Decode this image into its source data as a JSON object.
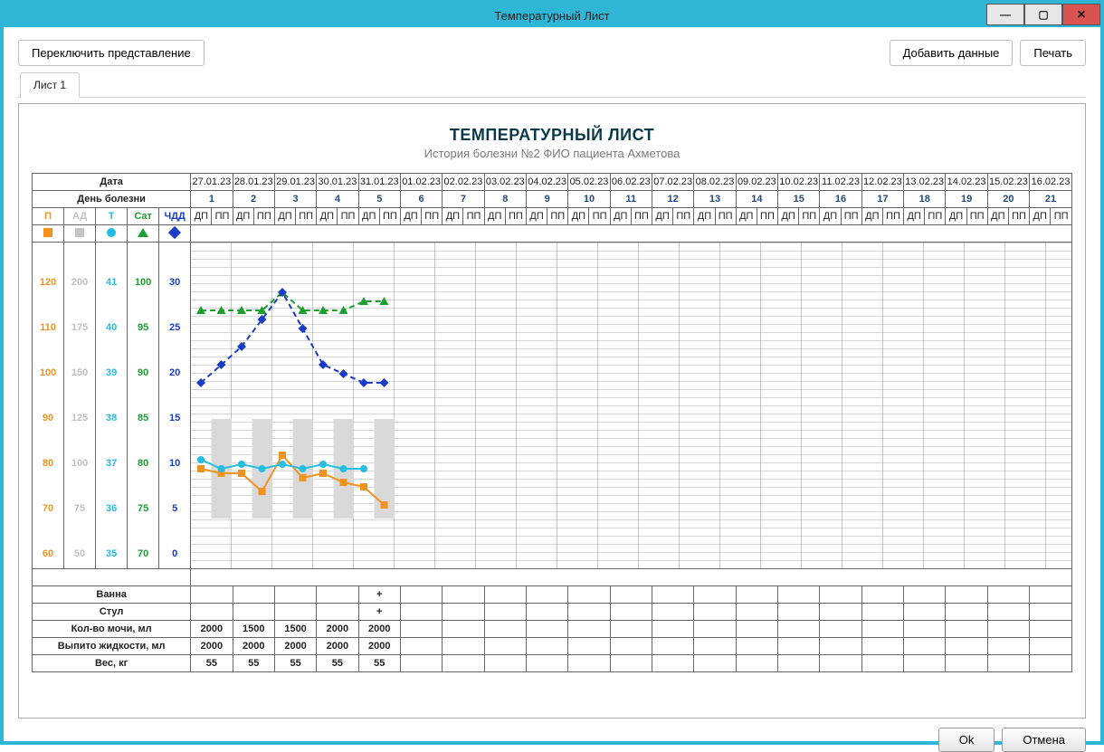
{
  "window": {
    "title": "Температурный Лист"
  },
  "toolbar": {
    "toggle_view": "Переключить представление",
    "add_data": "Добавить данные",
    "print": "Печать"
  },
  "tab": {
    "label": "Лист 1"
  },
  "sheet": {
    "title": "ТЕМПЕРАТУРНЫЙ ЛИСТ",
    "subtitle": "История болезни №2 ФИО пациента Ахметова"
  },
  "headers": {
    "date": "Дата",
    "day": "День болезни",
    "dp": "ДП",
    "pp": "ПП",
    "col_p": "П",
    "col_ad": "АД",
    "col_t": "Т",
    "col_sat": "Сат",
    "col_chdd": "ЧДД"
  },
  "dates": [
    "27.01.23",
    "28.01.23",
    "29.01.23",
    "30.01.23",
    "31.01.23",
    "01.02.23",
    "02.02.23",
    "03.02.23",
    "04.02.23",
    "05.02.23",
    "06.02.23",
    "07.02.23",
    "08.02.23",
    "09.02.23",
    "10.02.23",
    "11.02.23",
    "12.02.23",
    "13.02.23",
    "14.02.23",
    "15.02.23",
    "16.02.23"
  ],
  "days": [
    "1",
    "2",
    "3",
    "4",
    "5",
    "6",
    "7",
    "8",
    "9",
    "10",
    "11",
    "12",
    "13",
    "14",
    "15",
    "16",
    "17",
    "18",
    "19",
    "20",
    "21"
  ],
  "scales": {
    "p": [
      "120",
      "110",
      "100",
      "90",
      "80",
      "70",
      "60"
    ],
    "ad": [
      "200",
      "175",
      "150",
      "125",
      "100",
      "75",
      "50"
    ],
    "t": [
      "41",
      "40",
      "39",
      "38",
      "37",
      "36",
      "35"
    ],
    "sat": [
      "100",
      "95",
      "90",
      "85",
      "80",
      "75",
      "70"
    ],
    "chdd": [
      "30",
      "25",
      "20",
      "15",
      "10",
      "5",
      "0"
    ]
  },
  "rows": {
    "vanna": "Ванна",
    "stul": "Стул",
    "mochi": "Кол-во мочи, мл",
    "zhidkost": "Выпито жидкости, мл",
    "ves": "Вес, кг"
  },
  "row_data": {
    "vanna": [
      "",
      "",
      "",
      "",
      "+"
    ],
    "stul": [
      "",
      "",
      "",
      "",
      "+"
    ],
    "mochi": [
      "2000",
      "1500",
      "1500",
      "2000",
      "2000"
    ],
    "zhidkost": [
      "2000",
      "2000",
      "2000",
      "2000",
      "2000"
    ],
    "ves": [
      "55",
      "55",
      "55",
      "55",
      "55"
    ]
  },
  "chart_data": {
    "type": "line",
    "x": [
      "27ДП",
      "27ПП",
      "28ДП",
      "28ПП",
      "29ДП",
      "29ПП",
      "30ДП",
      "30ПП",
      "31ДП",
      "31ПП"
    ],
    "series": [
      {
        "name": "П (Пульс)",
        "color": "#f2931d",
        "shape": "square",
        "values": [
          79,
          78,
          78,
          74,
          82,
          77,
          78,
          76,
          75,
          71
        ],
        "range": [
          60,
          120
        ]
      },
      {
        "name": "Т (Температура)",
        "color": "#26bde2",
        "shape": "circle",
        "values": [
          37.1,
          36.9,
          37.0,
          36.9,
          37.0,
          36.9,
          37.0,
          36.9,
          36.9,
          null
        ],
        "range": [
          35,
          41
        ]
      },
      {
        "name": "Сат (Сатурация)",
        "color": "#1aa02e",
        "shape": "triangle",
        "values": [
          97,
          97,
          97,
          97,
          99,
          97,
          97,
          97,
          98,
          98
        ],
        "range": [
          70,
          100
        ]
      },
      {
        "name": "ЧДД",
        "color": "#1a3cc6",
        "shape": "diamond",
        "values": [
          19,
          21,
          23,
          26,
          29,
          25,
          21,
          20,
          19,
          19
        ],
        "range": [
          0,
          30
        ]
      }
    ]
  },
  "footer": {
    "ok": "Ok",
    "cancel": "Отмена"
  }
}
